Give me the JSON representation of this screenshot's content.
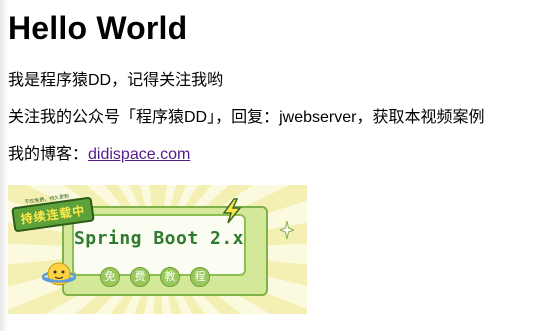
{
  "page": {
    "heading": "Hello World",
    "intro": "我是程序猿DD，记得关注我哟",
    "follow_text": "关注我的公众号「程序猿DD」，回复：jwebserver，获取本视频案例",
    "blog_prefix": "我的博客：",
    "blog_link_text": "didispace.com"
  },
  "banner": {
    "title": "Spring Boot 2.x",
    "tags": [
      "免",
      "费",
      "教",
      "程"
    ],
    "badge_small": "不仅免费，持久更新",
    "badge_main": "持续连载中",
    "colors": {
      "accent_green": "#2f7a2c",
      "panel_border": "#7fb04a",
      "rays_light": "#fbf9de",
      "rays_dark": "#f4f0b4"
    }
  },
  "colors": {
    "link": "#551a8b",
    "text": "#000000",
    "background": "#ffffff"
  }
}
